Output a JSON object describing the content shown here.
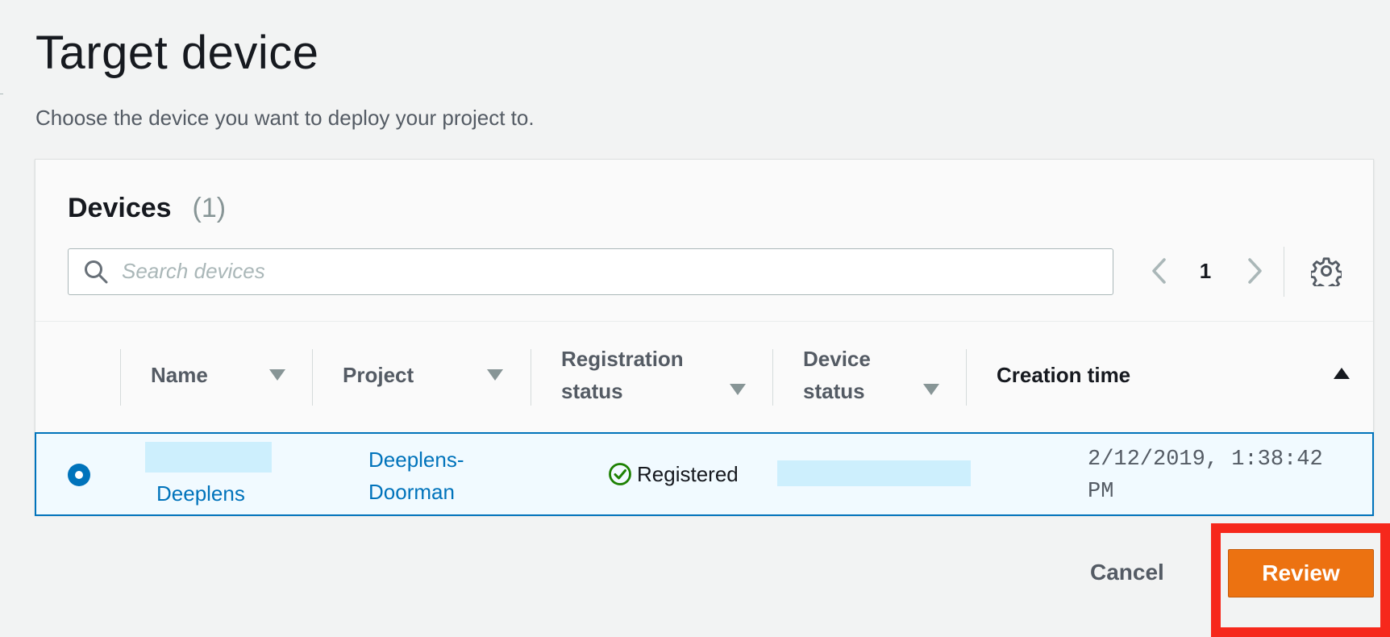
{
  "page": {
    "title": "Target device",
    "description": "Choose the device you want to deploy your project to."
  },
  "devices_panel": {
    "heading": "Devices",
    "count": "(1)",
    "search": {
      "placeholder": "Search devices",
      "value": ""
    },
    "pagination": {
      "current_page": "1"
    },
    "icons": {
      "search": "search-icon",
      "prev": "chevron-left-icon",
      "next": "chevron-right-icon",
      "settings": "gear-icon",
      "sort_desc": "caret-down-icon",
      "sort_asc": "caret-up-icon",
      "status_ok": "check-circle-icon"
    }
  },
  "table": {
    "columns": {
      "name": "Name",
      "project": "Project",
      "registration_status_line1": "Registration",
      "registration_status_line2": "status",
      "device_status_line1": "Device",
      "device_status_line2": "status",
      "creation_time": "Creation time"
    },
    "sort": {
      "active_column": "creation_time",
      "direction": "ascending"
    },
    "rows": [
      {
        "selected": true,
        "name": "Deeplens",
        "project_line1": "Deeplens-",
        "project_line2": "Doorman",
        "registration_status": "Registered",
        "creation_time_line1": "2/12/2019, 1:38:42",
        "creation_time_line2": "PM"
      }
    ]
  },
  "actions": {
    "cancel_label": "Cancel",
    "review_label": "Review"
  },
  "colors": {
    "primary_button": "#ec7211",
    "link": "#0073bb",
    "selected_row_border": "#0073bb",
    "selected_row_bg": "#f1faff",
    "success": "#1d8102",
    "highlight": "#f6281c",
    "redaction": "#cdeffd"
  }
}
